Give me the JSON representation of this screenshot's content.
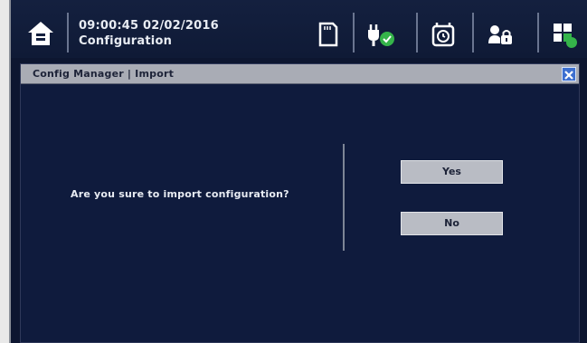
{
  "header": {
    "timestamp": "09:00:45 02/02/2016",
    "screen": "Configuration"
  },
  "toolbar": {
    "icons": [
      "home-icon",
      "sd-card-icon",
      "power-plug-ok-icon",
      "alarm-clock-icon",
      "user-lock-icon",
      "grid-status-icon"
    ]
  },
  "dialog": {
    "title": "Config Manager | Import",
    "message": "Are you sure to import configuration?",
    "yes_label": "Yes",
    "no_label": "No",
    "close_glyph": "✕"
  },
  "colors": {
    "background": "#0f1b3d",
    "titlebar": "#a9acb5",
    "button": "#b9bcc4",
    "accent_green": "#35b44a",
    "close_blue": "#3d6fd0"
  }
}
